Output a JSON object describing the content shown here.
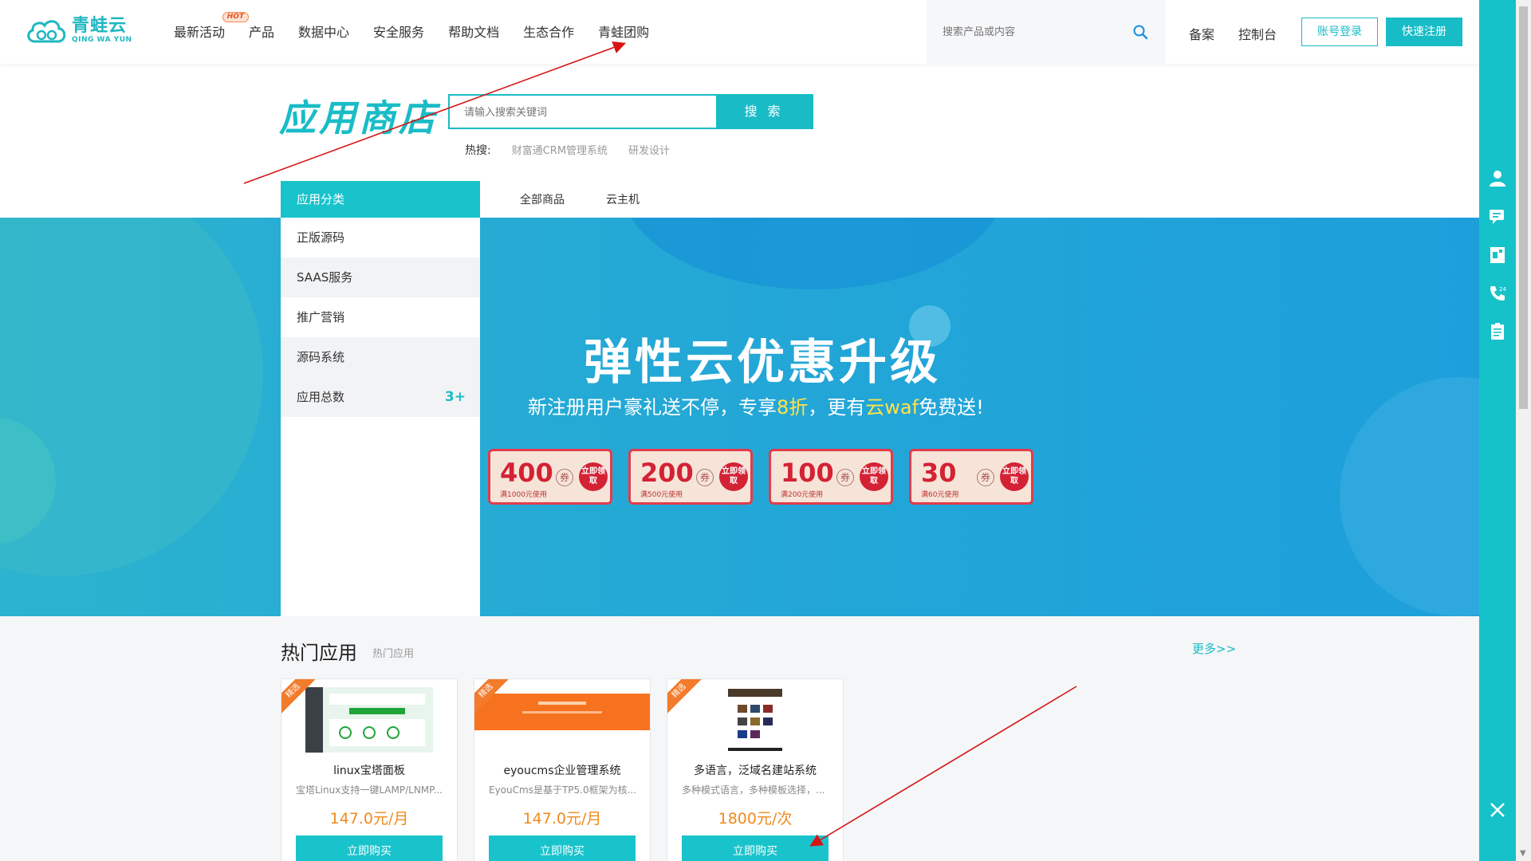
{
  "header": {
    "logo_cn": "青蛙云",
    "logo_en": "QING WA YUN",
    "nav": [
      "最新活动",
      "产品",
      "数据中心",
      "安全服务",
      "帮助文档",
      "生态合作",
      "青蛙团购"
    ],
    "hot_badge": "HOT",
    "search_placeholder": "搜索产品或内容",
    "link_beian": "备案",
    "link_console": "控制台",
    "login_label": "账号登录",
    "register_label": "快速注册"
  },
  "store": {
    "title": "应用商店",
    "search_placeholder": "请输入搜索关键词",
    "search_button": "搜 索",
    "hot_label": "热搜:",
    "hot_keywords": [
      "财富通CRM管理系统",
      "研发设计"
    ]
  },
  "category": {
    "head": "应用分类",
    "items": [
      "正版源码",
      "SAAS服务",
      "推广营销",
      "源码系统",
      "应用总数"
    ],
    "total_count": "3+"
  },
  "tabs": [
    "全部商品",
    "云主机"
  ],
  "banner": {
    "title": "弹性云优惠升级",
    "sub_prefix": "新注册用户豪礼送不停，专享",
    "sub_hl1": "8折",
    "sub_mid": "，更有",
    "sub_hl2": "云waf",
    "sub_suffix": "免费送!",
    "coupons": [
      {
        "amount": "400",
        "condition": "满1000元使用"
      },
      {
        "amount": "200",
        "condition": "满500元使用"
      },
      {
        "amount": "100",
        "condition": "满200元使用"
      },
      {
        "amount": "30",
        "condition": "满60元使用"
      }
    ],
    "coupon_unit": "券",
    "coupon_get": "立即领取"
  },
  "hot_apps": {
    "title": "热门应用",
    "subtitle": "热门应用",
    "more": "更多>>",
    "ribbon": "精选",
    "cards": [
      {
        "name": "linux宝塔面板",
        "desc": "宝塔Linux支持一键LAMP/LNMP...",
        "price": "147.0元/月",
        "button": "立即购买"
      },
      {
        "name": "eyoucms企业管理系统",
        "desc": "EyouCms是基于TP5.0框架为核...",
        "price": "147.0元/月",
        "button": "立即购买"
      },
      {
        "name": "多语言，泛域名建站系统",
        "desc": "多种模式语言，多种模板选择，...",
        "price": "1800元/次",
        "button": "立即购买"
      }
    ]
  },
  "colors": {
    "accent": "#19bcc6",
    "price": "#f08a1d",
    "coupon_red": "#d42235",
    "annotation": "#d61414"
  }
}
